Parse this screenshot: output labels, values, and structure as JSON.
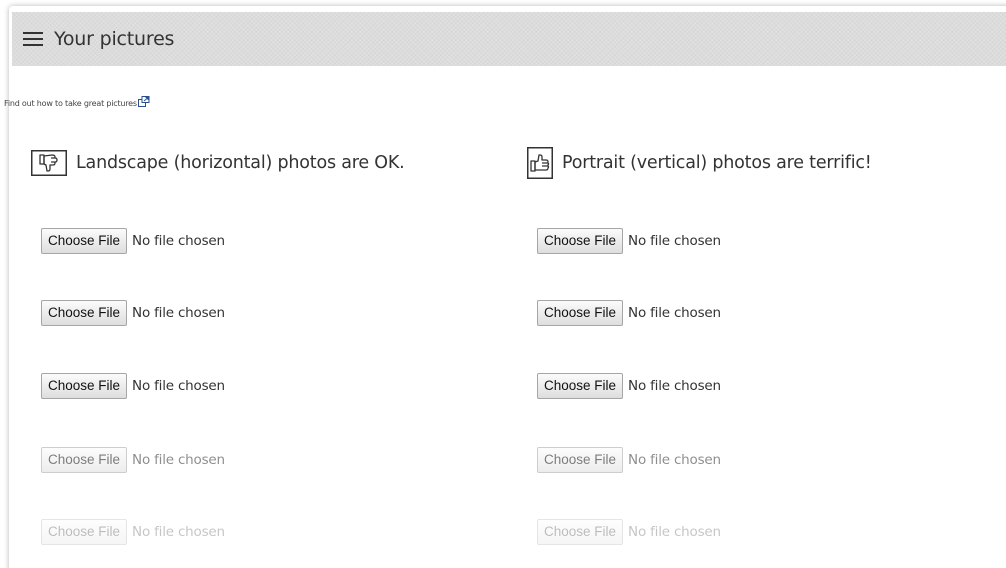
{
  "header": {
    "title": "Your pictures",
    "menu_icon": "hamburger-menu-icon"
  },
  "help_link": {
    "text": "Find out how to take great pictures",
    "icon": "external-link-icon"
  },
  "columns": [
    {
      "heading": "Landscape (horizontal) photos are OK.",
      "icon": "thumbs-down-icon",
      "inputs": [
        {
          "button_label": "Choose File",
          "status": "No file chosen"
        },
        {
          "button_label": "Choose File",
          "status": "No file chosen"
        },
        {
          "button_label": "Choose File",
          "status": "No file chosen"
        },
        {
          "button_label": "Choose File",
          "status": "No file chosen"
        },
        {
          "button_label": "Choose File",
          "status": "No file chosen"
        }
      ]
    },
    {
      "heading": "Portrait (vertical) photos are terrific!",
      "icon": "thumbs-up-icon",
      "inputs": [
        {
          "button_label": "Choose File",
          "status": "No file chosen"
        },
        {
          "button_label": "Choose File",
          "status": "No file chosen"
        },
        {
          "button_label": "Choose File",
          "status": "No file chosen"
        },
        {
          "button_label": "Choose File",
          "status": "No file chosen"
        },
        {
          "button_label": "Choose File",
          "status": "No file chosen"
        }
      ]
    }
  ],
  "colors": {
    "header_background": "#dcdcdc",
    "text": "#333333",
    "button_border": "#a6a6a6"
  }
}
